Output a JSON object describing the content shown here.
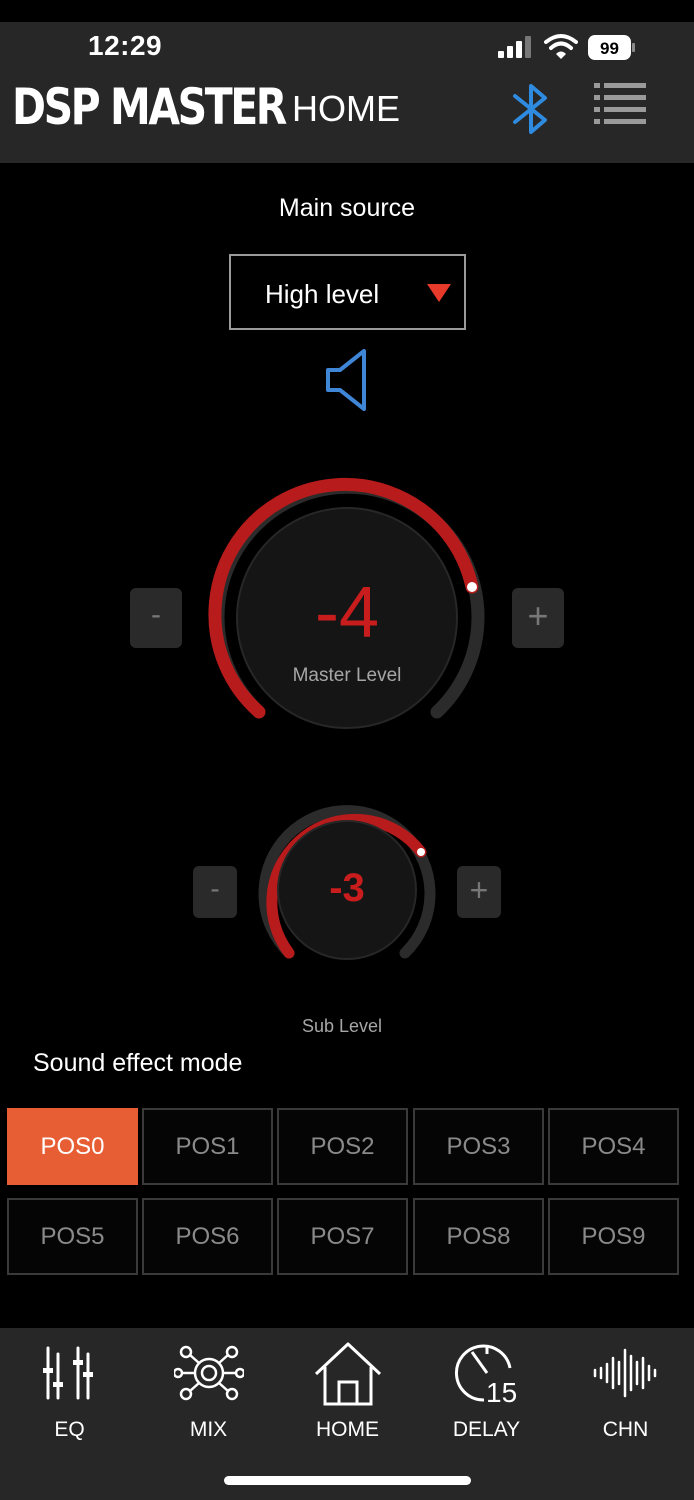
{
  "status_bar": {
    "time": "12:29",
    "battery": "99"
  },
  "header": {
    "brand": "DSP MASTER",
    "title": "HOME"
  },
  "main_source": {
    "label": "Main source",
    "selected": "High level"
  },
  "master_level": {
    "value": "-4",
    "label": "Master Level",
    "minus": "-",
    "plus": "+"
  },
  "sub_level": {
    "value": "-3",
    "label": "Sub Level",
    "minus": "-",
    "plus": "+"
  },
  "sound_effect": {
    "label": "Sound effect mode",
    "positions": [
      "POS0",
      "POS1",
      "POS2",
      "POS3",
      "POS4",
      "POS5",
      "POS6",
      "POS7",
      "POS8",
      "POS9"
    ],
    "active": "POS0"
  },
  "tabs": [
    {
      "label": "EQ",
      "icon": "eq-sliders-icon"
    },
    {
      "label": "MIX",
      "icon": "mix-network-icon"
    },
    {
      "label": "HOME",
      "icon": "home-icon"
    },
    {
      "label": "DELAY",
      "icon": "delay-timer-icon",
      "badge": "15"
    },
    {
      "label": "CHN",
      "icon": "channel-waveform-icon"
    }
  ],
  "colors": {
    "accent": "#c91d1d",
    "active_pos": "#e85e34",
    "bluetooth": "#2f8be0",
    "bar": "#272727"
  }
}
